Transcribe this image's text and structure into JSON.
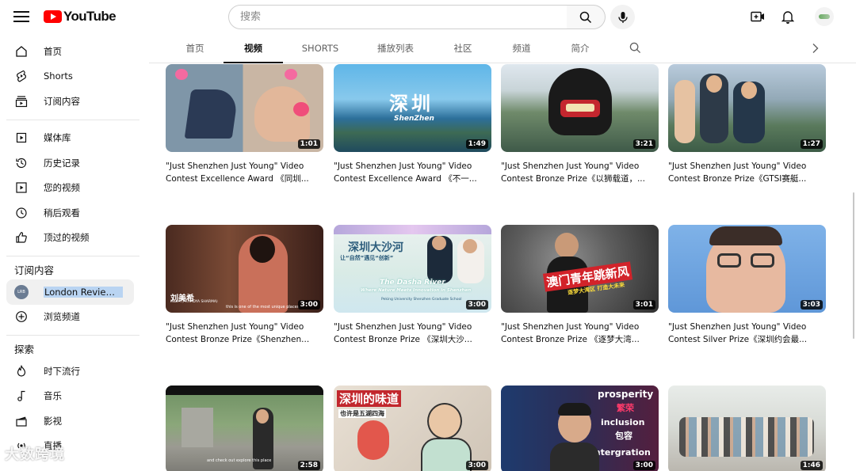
{
  "header": {
    "logo_text": "YouTube",
    "search_placeholder": "搜索",
    "icons": [
      "menu-icon",
      "search-icon",
      "mic-icon",
      "create-icon",
      "bell-icon",
      "avatar"
    ]
  },
  "sidebar": {
    "main": [
      {
        "label": "首页",
        "icon": "home-icon"
      },
      {
        "label": "Shorts",
        "icon": "shorts-icon"
      },
      {
        "label": "订阅内容",
        "icon": "subscriptions-icon"
      }
    ],
    "library": [
      {
        "label": "媒体库",
        "icon": "library-icon"
      },
      {
        "label": "历史记录",
        "icon": "history-icon"
      },
      {
        "label": "您的视频",
        "icon": "your-videos-icon"
      },
      {
        "label": "稍后观看",
        "icon": "watch-later-icon"
      },
      {
        "label": "顶过的视频",
        "icon": "liked-icon"
      }
    ],
    "subscriptions_heading": "订阅内容",
    "subscriptions": [
      {
        "label": "London Review Boo...",
        "avatar_text": "LRB"
      },
      {
        "label": "浏览频道",
        "icon": "add-circle-icon"
      }
    ],
    "explore_heading": "探索",
    "explore": [
      {
        "label": "时下流行",
        "icon": "trending-icon"
      },
      {
        "label": "音乐",
        "icon": "music-icon"
      },
      {
        "label": "影视",
        "icon": "film-icon"
      },
      {
        "label": "直播",
        "icon": "live-icon"
      }
    ]
  },
  "tabs": [
    "首页",
    "视频",
    "SHORTS",
    "播放列表",
    "社区",
    "频道",
    "简介"
  ],
  "selected_tab": "视频",
  "videos": [
    {
      "duration": "1:01",
      "title1": "\"Just Shenzhen Just Young\" Video",
      "title2": "Contest Excellence Award 《同圳..."
    },
    {
      "duration": "1:49",
      "title1": "\"Just Shenzhen Just Young\" Video",
      "title2": "Contest Excellence Award 《不一...",
      "overlay": "深圳",
      "overlay_sub": "ShenZhen"
    },
    {
      "duration": "3:21",
      "title1": "\"Just Shenzhen Just Young\" Video",
      "title2": "Contest Bronze Prize《以狮载道，..."
    },
    {
      "duration": "1:27",
      "title1": "\"Just Shenzhen Just Young\" Video",
      "title2": "Contest Bronze Prize《GTSI赛艇..."
    },
    {
      "duration": "3:00",
      "title1": "\"Just Shenzhen Just Young\" Video",
      "title2": "Contest Bronze Prize《Shenzhen...",
      "overlay": "刘美希",
      "overlay_sub": "INDIA (PRIYADYA SHARMA)",
      "caption": "this is one of the most unique places"
    },
    {
      "duration": "3:00",
      "title1": "\"Just Shenzhen Just Young\" Video",
      "title2": "Contest Bronze Prize 《深圳大沙...",
      "overlay": "深圳大沙河",
      "overlay_sub": "让“自然”遇见“创新”",
      "caption": "The Dasha River",
      "caption2": "Where Nature Meets Innovation in Shenzhen",
      "caption3": "Peking University Shenzhen Graduate School"
    },
    {
      "duration": "3:01",
      "title1": "\"Just Shenzhen Just Young\" Video",
      "title2": "Contest Bronze Prize 《逐梦大湾...",
      "overlay": "澳门青年跳新风",
      "overlay_sub": "逐梦大湾区 打造大未来"
    },
    {
      "duration": "3:03",
      "title1": "\"Just Shenzhen Just Young\" Video",
      "title2": "Contest Silver Prize《深圳约会最..."
    },
    {
      "duration": "2:58",
      "title1": "",
      "title2": "",
      "caption": "and check out explore this place"
    },
    {
      "duration": "3:00",
      "title1": "",
      "title2": "",
      "overlay": "深圳的味道",
      "overlay_sub": "也许是五湖四海"
    },
    {
      "duration": "3:00",
      "title1": "",
      "title2": "",
      "overlay": "prosperity",
      "overlay_sub": "繁荣",
      "caption": "inclusion",
      "caption2": "包容",
      "caption3": "intergration"
    },
    {
      "duration": "1:46",
      "title1": "",
      "title2": ""
    }
  ],
  "watermark": "大数跨境"
}
